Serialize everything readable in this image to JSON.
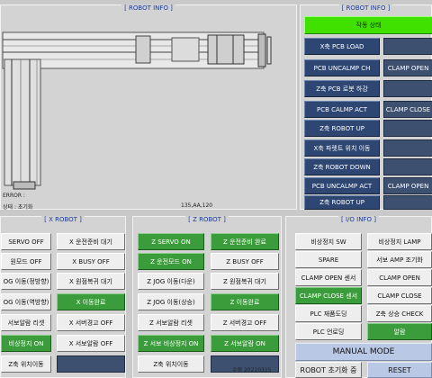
{
  "top_left": {
    "title": "[ ROBOT INFO ]",
    "error_text": "ERROR :",
    "state_text": "상태 : 초기화",
    "coord_text": "135,AA,120"
  },
  "top_right": {
    "title": "[ ROBOT INFO ]",
    "status": "작동 상태",
    "rows": [
      {
        "label": "X축 PCB LOAD",
        "value": ""
      },
      {
        "label": "PCB UNCALMP CH",
        "value": "CLAMP OPEN"
      },
      {
        "label": "Z축 PCB 로봇 하강",
        "value": ""
      },
      {
        "label": "PCB CALMP ACT",
        "value": "CLAMP CLOSE"
      },
      {
        "label": "Z축 ROBOT UP",
        "value": ""
      },
      {
        "label": "X축 파렛트 위치 이동",
        "value": ""
      },
      {
        "label": "Z축 ROBOT DOWN",
        "value": ""
      },
      {
        "label": "PCB UNCALMP ACT",
        "value": "CLAMP OPEN"
      },
      {
        "label": "Z축 ROBOT UP",
        "value": ""
      }
    ]
  },
  "x_robot": {
    "title": "[ X ROBOT ]",
    "left": [
      "SERVO OFF",
      "원모드 OFF",
      "OG 이동(정방향)",
      "OG 이동(역방향)",
      "서보알람 리셋",
      "비상정지 ON",
      "Z축 위치이동"
    ],
    "right": [
      "X 운전준비 대기",
      "X BUSY OFF",
      "X 원점복귀 대기",
      "X 이동완료",
      "X 서버경고 OFF",
      "X 서보알람 OFF",
      ""
    ]
  },
  "z_robot": {
    "title": "[ Z ROBOT ]",
    "left": [
      "Z SERVO ON",
      "Z 운전모드 ON",
      "Z JOG 이동(다운)",
      "Z JOG 이동(상승)",
      "Z 서보알람 리셋",
      "Z 서보 비상정지 ON",
      "Z축 위치이동"
    ],
    "right": [
      "Z 운전준비 완료",
      "Z BUSY OFF",
      "Z 원점복귀 대기",
      "Z 이동완료",
      "Z 서버경고 OFF",
      "Z 서보알람 ON",
      ""
    ]
  },
  "io_info": {
    "title": "[ I/O INFO ]",
    "left": [
      "비상정지 SW",
      "SPARE",
      "CLAMP OPEN 센서",
      "CLAMP CLOSE 센서",
      "PLC 재품도딩",
      "PLC 언로딩"
    ],
    "right": [
      "비상정지 LAMP",
      "서보 AMP 조기화",
      "CLAMP OPEN",
      "CLAMP CLOSE",
      "Z축 상승 CHECK",
      "알람"
    ],
    "manual_mode": "MANUAL MODE",
    "init_button": "ROBOT 초기화 중",
    "reset_button": "RESET",
    "version": "수정 20210315"
  },
  "colors": {
    "navy": "#2d4672",
    "green": "#3a9c3a",
    "lime": "#40e000",
    "lavender": "#b9c8e5"
  }
}
